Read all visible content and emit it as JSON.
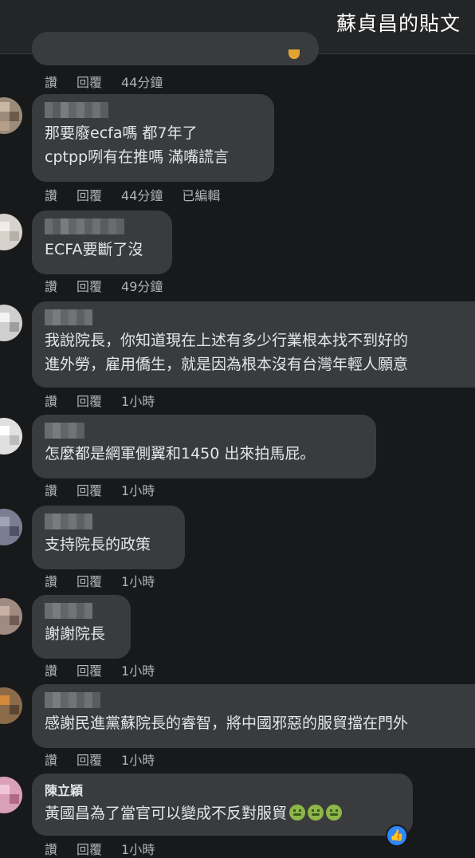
{
  "header": {
    "title": "蘇貞昌的貼文"
  },
  "action_labels": {
    "like": "讚",
    "reply": "回覆",
    "edited": "已編輯"
  },
  "comments": [
    {
      "author": "",
      "text_lines": [],
      "time": "44分鐘"
    },
    {
      "author": "",
      "text_lines": [
        "那要廢ecfa嗎 都7年了",
        "cptpp咧有在推嗎 滿嘴謊言"
      ],
      "time": "44分鐘"
    },
    {
      "author": "",
      "text_lines": [
        "ECFA要斷了沒"
      ],
      "time": "49分鐘"
    },
    {
      "author": "",
      "text_lines": [
        "我說院長，你知道現在上述有多少行業根本找不到好的",
        "進外勞，雇用僑生，就是因為根本沒有台灣年輕人願意"
      ],
      "time": "1小時"
    },
    {
      "author": "",
      "text_lines": [
        "怎麼都是網軍側翼和1450 出來拍馬屁。"
      ],
      "time": "1小時"
    },
    {
      "author": "",
      "text_lines": [
        "支持院長的政策"
      ],
      "time": "1小時"
    },
    {
      "author": "",
      "text_lines": [
        "謝謝院長"
      ],
      "time": "1小時"
    },
    {
      "author": "",
      "text_lines": [
        "感謝民進黨蘇院長的睿智，將中國邪惡的服貿擋在門外"
      ],
      "time": "1小時"
    },
    {
      "author": "陳立穎",
      "text_lines": [
        "黃國昌為了當官可以變成不反對服貿"
      ],
      "time": "1小時",
      "emoji": [
        "nauseated-face",
        "nauseated-face",
        "nauseated-face"
      ],
      "reaction": "like"
    }
  ],
  "colors": {
    "background": "#18191a",
    "bubble": "#3a3b3c",
    "text": "#e4e6eb",
    "secondary_text": "#b0b3b8",
    "like_blue": "#2d88ff"
  }
}
